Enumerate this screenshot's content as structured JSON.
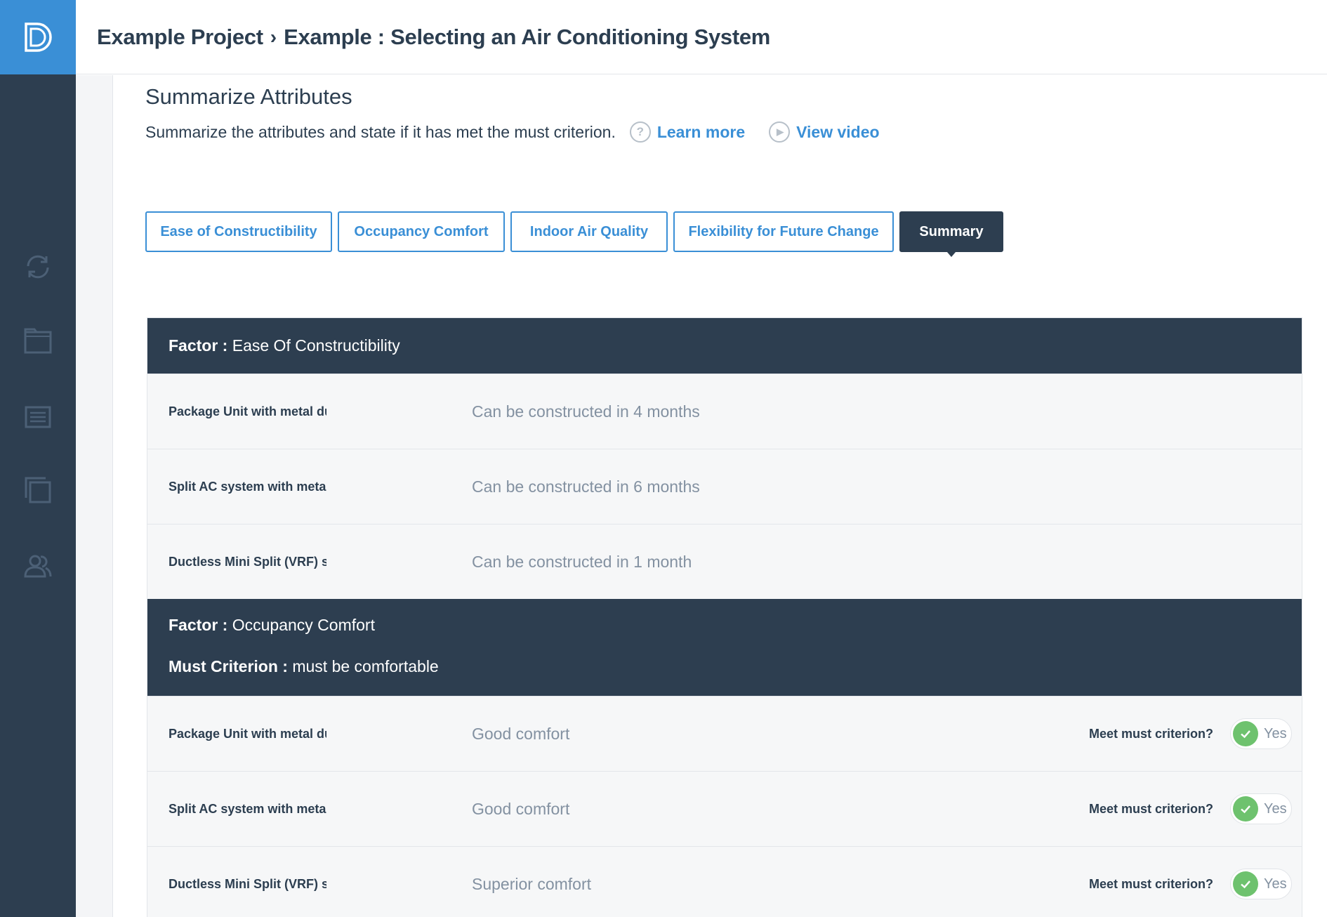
{
  "header": {
    "project": "Example Project",
    "separator": "›",
    "page": "Example : Selecting an Air Conditioning System"
  },
  "sidebar": {
    "icons": [
      "sync-icon",
      "folder-icon",
      "list-icon",
      "copy-icon",
      "users-icon"
    ],
    "accent": "#3a8fd6",
    "background": "#2d3e50"
  },
  "section": {
    "title": "Summarize Attributes",
    "description": "Summarize the attributes and state if it has met the must criterion.",
    "learn_more": "Learn more",
    "learn_more_glyph": "?",
    "view_video": "View video",
    "view_video_glyph": "▶"
  },
  "tabs": [
    {
      "label": "Ease of Constructibility",
      "active": false
    },
    {
      "label": "Occupancy Comfort",
      "active": false
    },
    {
      "label": "Indoor Air Quality",
      "active": false
    },
    {
      "label": "Flexibility for Future Change",
      "active": false
    },
    {
      "label": "Summary",
      "active": true
    }
  ],
  "factors": [
    {
      "factor_label": "Factor :",
      "factor_name": "Ease Of Constructibility",
      "rows": [
        {
          "option": "Package Unit with metal duc",
          "value": "Can be constructed in 4 months"
        },
        {
          "option": "Split AC system with metal d",
          "value": "Can be constructed in 6 months"
        },
        {
          "option": "Ductless Mini Split (VRF) sys",
          "value": "Can be constructed in 1 month"
        }
      ]
    },
    {
      "factor_label": "Factor :",
      "factor_name": "Occupancy Comfort",
      "criterion_label": "Must Criterion :",
      "criterion": "must be comfortable",
      "meet_label": "Meet must criterion?",
      "toggle_label": "Yes",
      "rows": [
        {
          "option": "Package Unit with metal duc",
          "value": "Good comfort",
          "meets": true
        },
        {
          "option": "Split AC system with metal d",
          "value": "Good comfort",
          "meets": true
        },
        {
          "option": "Ductless Mini Split (VRF) sys",
          "value": "Superior comfort",
          "meets": true
        }
      ]
    }
  ]
}
